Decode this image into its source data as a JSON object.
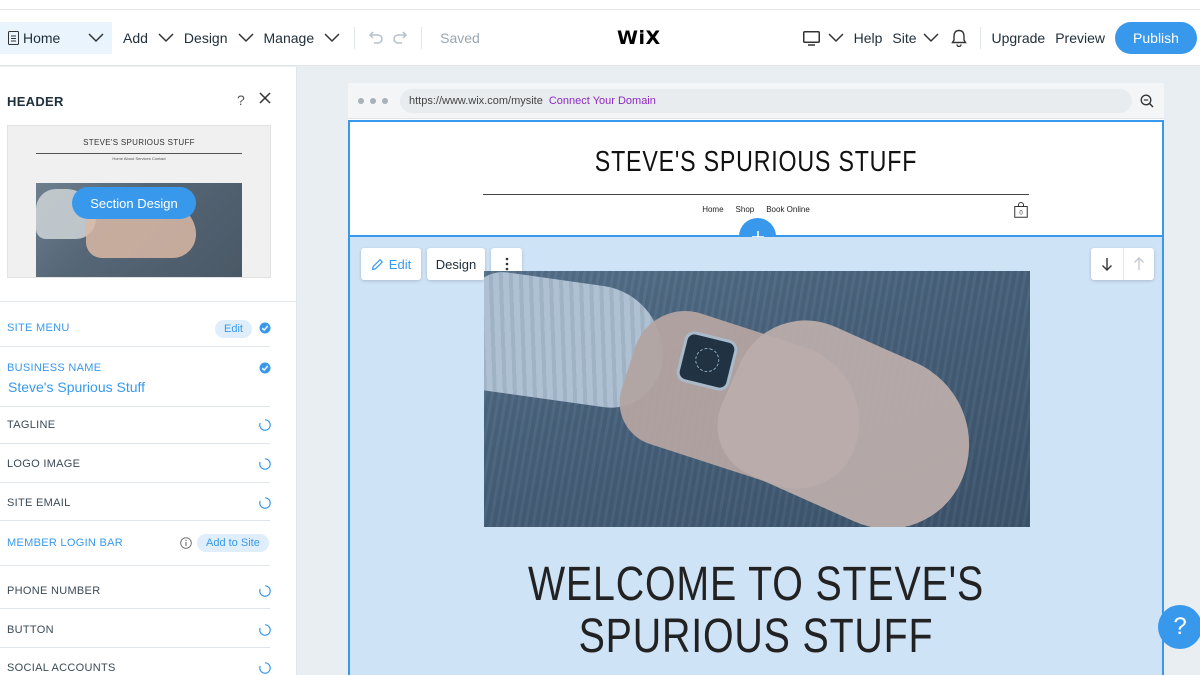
{
  "topbar": {
    "home_label": "Home",
    "menu": [
      {
        "label": "Add"
      },
      {
        "label": "Design"
      },
      {
        "label": "Manage"
      }
    ],
    "saved_label": "Saved",
    "logo_text": "WiX",
    "help_label": "Help",
    "site_label": "Site",
    "upgrade_label": "Upgrade",
    "preview_label": "Preview",
    "publish_label": "Publish"
  },
  "panel": {
    "title": "HEADER",
    "help_glyph": "?",
    "thumbnail": {
      "site_name": "STEVE'S SPURIOUS STUFF",
      "nav_text": "Home   About   Services   Contact",
      "section_design_label": "Section Design"
    },
    "rows": [
      {
        "label": "SITE MENU",
        "action": "Edit",
        "status": "checked"
      },
      {
        "label": "BUSINESS NAME",
        "value": "Steve's Spurious Stuff",
        "status": "checked"
      },
      {
        "label": "TAGLINE",
        "status": "empty"
      },
      {
        "label": "LOGO IMAGE",
        "status": "empty"
      },
      {
        "label": "SITE EMAIL",
        "status": "empty"
      },
      {
        "label": "MEMBER LOGIN BAR",
        "action": "Add to Site",
        "status": "info"
      },
      {
        "label": "PHONE NUMBER",
        "status": "empty"
      },
      {
        "label": "BUTTON",
        "status": "empty"
      },
      {
        "label": "SOCIAL ACCOUNTS",
        "status": "empty"
      }
    ]
  },
  "browser": {
    "url": "https://www.wix.com/mysite",
    "connect_label": "Connect Your Domain"
  },
  "site": {
    "name": "STEVE'S SPURIOUS STUFF",
    "nav": [
      "Home",
      "Shop",
      "Book Online"
    ],
    "cart_count": "0",
    "toolbar": {
      "edit_label": "Edit",
      "design_label": "Design"
    },
    "welcome_line1": "WELCOME TO STEVE'S",
    "welcome_line2": "SPURIOUS STUFF"
  },
  "help_bubble": "?",
  "colors": {
    "accent": "#3899ec",
    "connect": "#8b2ac2",
    "section_bg": "#cfe3f7"
  }
}
